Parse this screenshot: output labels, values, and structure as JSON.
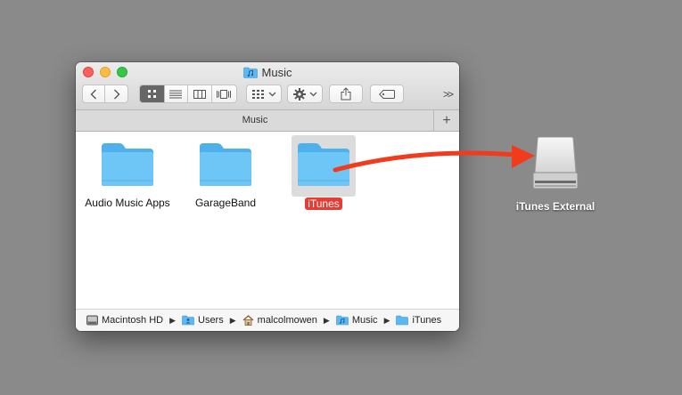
{
  "window": {
    "title": "Music",
    "tab_label": "Music",
    "tab_add": "+"
  },
  "toolbar": {
    "back": "back",
    "forward": "forward",
    "views": [
      "icon-view",
      "list-view",
      "column-view",
      "cover-flow-view"
    ],
    "active_view": "icon-view",
    "group_by": "group-by",
    "action": "action-gear",
    "share": "share",
    "tags": "tags",
    "overflow": ">>"
  },
  "items": [
    {
      "name": "Audio Music Apps",
      "icon": "folder-icon",
      "selected": false
    },
    {
      "name": "GarageBand",
      "icon": "folder-icon",
      "selected": false
    },
    {
      "name": "iTunes",
      "icon": "folder-icon",
      "selected": true
    }
  ],
  "path": [
    {
      "label": "Macintosh HD",
      "icon": "hard-disk-icon"
    },
    {
      "label": "Users",
      "icon": "folder-users-icon"
    },
    {
      "label": "malcolmowen",
      "icon": "home-icon"
    },
    {
      "label": "Music",
      "icon": "music-folder-icon"
    },
    {
      "label": "iTunes",
      "icon": "folder-icon"
    }
  ],
  "desktop": {
    "drive_name": "iTunes External",
    "drive_icon": "external-drive-icon"
  },
  "colors": {
    "folder": "#66c1f6",
    "selection_label": "#e53d36",
    "arrow": "#f23a1c",
    "desktop": "#8a8a8a"
  }
}
